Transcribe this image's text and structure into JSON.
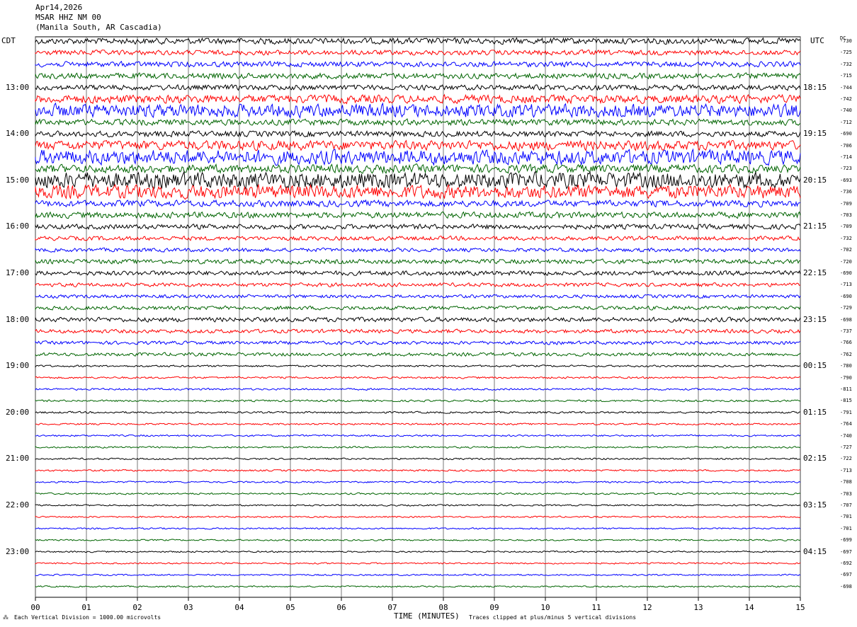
{
  "header": {
    "date": "Apr14,2026",
    "station": "MSAR HHZ NM 00",
    "location": "(Manila South, AR Cascadia)"
  },
  "tz_left": "CDT",
  "tz_right": "UTC",
  "dc_header": "DC",
  "footer": {
    "scale_note": "Each Vertical Division = 1000.00 microvolts",
    "clip_note": "Traces clipped at plus/minus 5 vertical divisions"
  },
  "chart_data": {
    "type": "line",
    "title": "Apr14,2026 MSAR HHZ NM 00 (Manila South, AR Cascadia)",
    "xlabel": "TIME (MINUTES)",
    "x_ticks": [
      "00",
      "01",
      "02",
      "03",
      "04",
      "05",
      "06",
      "07",
      "08",
      "09",
      "10",
      "11",
      "12",
      "13",
      "14",
      "15"
    ],
    "xlim": [
      0,
      15
    ],
    "trace_colors": [
      "#000000",
      "#ff0000",
      "#0000ff",
      "#006400"
    ],
    "rows_per_hour": 4,
    "left_time_labels": [
      "13:00",
      "14:00",
      "15:00",
      "16:00",
      "17:00",
      "18:00",
      "19:00",
      "20:00",
      "21:00",
      "22:00",
      "23:00"
    ],
    "right_time_labels": [
      "18:15",
      "19:15",
      "20:15",
      "21:15",
      "22:15",
      "23:15",
      "00:15",
      "01:15",
      "02:15",
      "03:15",
      "04:15"
    ],
    "dc_offsets": [
      "-730",
      "-725",
      "-732",
      "-715",
      "-744",
      "-742",
      "-740",
      "-712",
      "-690",
      "-706",
      "-714",
      "-723",
      "-693",
      "-736",
      "-709",
      "-703",
      "-709",
      "-732",
      "-702",
      "-720",
      "-690",
      "-713",
      "-690",
      "-729",
      "-698",
      "-737",
      "-766",
      "-762",
      "-780",
      "-790",
      "-811",
      "-815",
      "-791",
      "-764",
      "-740",
      "-727",
      "-722",
      "-713",
      "-708",
      "-703",
      "-707",
      "-701",
      "-701",
      "-699",
      "-697",
      "-692",
      "-697",
      "-698"
    ],
    "row_amplitude_divisions": [
      1.6,
      1.3,
      1.4,
      1.5,
      1.4,
      2.2,
      3.5,
      1.6,
      1.5,
      2.5,
      3.8,
      2.2,
      4.2,
      3.6,
      1.7,
      1.6,
      1.3,
      1.1,
      1.0,
      1.2,
      1.2,
      1.0,
      0.9,
      1.0,
      1.2,
      1.0,
      0.9,
      0.9,
      0.5,
      0.5,
      0.5,
      0.5,
      0.5,
      0.45,
      0.45,
      0.45,
      0.45,
      0.45,
      0.45,
      0.45,
      0.4,
      0.4,
      0.4,
      0.4,
      0.4,
      0.4,
      0.4,
      0.4
    ],
    "grid": true
  }
}
